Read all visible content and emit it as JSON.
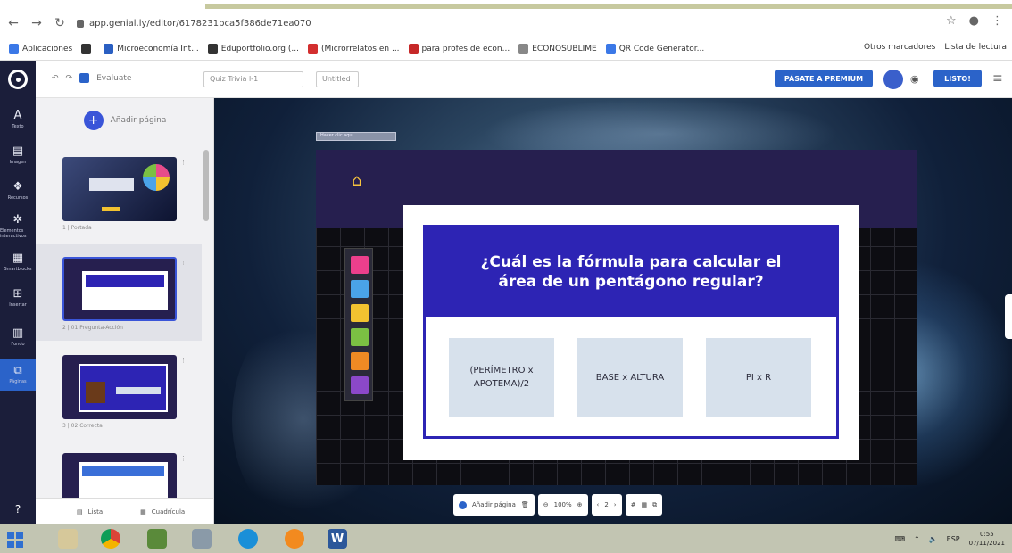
{
  "browser": {
    "url": "app.genial.ly/editor/6178231bca5f386de71ea070",
    "bookmarks": [
      {
        "label": "Aplicaciones",
        "color": "#3b78e7"
      },
      {
        "label": "",
        "color": "#333333"
      },
      {
        "label": "Microeconomía Int...",
        "color": "#2a5fc2"
      },
      {
        "label": "Eduportfolio.org (...",
        "color": "#333333"
      },
      {
        "label": "(Microrrelatos en ...",
        "color": "#d32f2f"
      },
      {
        "label": "para profes de econ...",
        "color": "#c62828"
      },
      {
        "label": "ECONOSUBLIME",
        "color": "#888888"
      },
      {
        "label": "QR Code Generator...",
        "color": "#3b78e7"
      }
    ],
    "bookmarks_right": [
      "Otros marcadores",
      "Lista de lectura"
    ]
  },
  "genially": {
    "title_field": "Quiz Trivia l-1",
    "second_field": "Untitled",
    "breadcrumb": "Evaluate",
    "premium_label": "PÁSATE A PREMIUM",
    "save_label": "LISTO!",
    "sidebar": [
      {
        "icon": "A",
        "label": "Texto"
      },
      {
        "icon": "▤",
        "label": "Imagen"
      },
      {
        "icon": "❖",
        "label": "Recursos"
      },
      {
        "icon": "✲",
        "label": "Elementos interactivos"
      },
      {
        "icon": "▦",
        "label": "Smartblocks"
      },
      {
        "icon": "⊞",
        "label": "Insertar"
      },
      {
        "icon": "▥",
        "label": "Fondo"
      },
      {
        "icon": "⧉",
        "label": "Páginas"
      }
    ],
    "pages_panel": {
      "add_page": "Añadir página",
      "pages": [
        {
          "label": "1 | Portada"
        },
        {
          "label": "2 | 01 Pregunta-Acción"
        },
        {
          "label": "3 | 02 Correcta"
        },
        {
          "label": ""
        }
      ],
      "view_list": "Lista",
      "view_grid": "Cuadrícula"
    },
    "canvas_tag": "Hacer clic aquí"
  },
  "slide": {
    "question": "¿Cuál es la fórmula para calcular el área de un pentágono regular?",
    "answers": [
      "(PERÍMETRO x APOTEMA)/2",
      "BASE x ALTURA",
      "PI x R"
    ],
    "strip_colors": [
      "#ec3f8c",
      "#4aa3e8",
      "#f2c230",
      "#7bc043",
      "#f08a24",
      "#8b48c9"
    ],
    "header_color": "#261f4f",
    "question_bg": "#2d24b4",
    "answer_bg": "#d7e1ec"
  },
  "bottom_toolbar": {
    "add_page": "Añadir página",
    "zoom": "100%",
    "page_indicator": "2"
  },
  "taskbar": {
    "language": "ESP",
    "time": "0:55",
    "date": "07/11/2021"
  }
}
